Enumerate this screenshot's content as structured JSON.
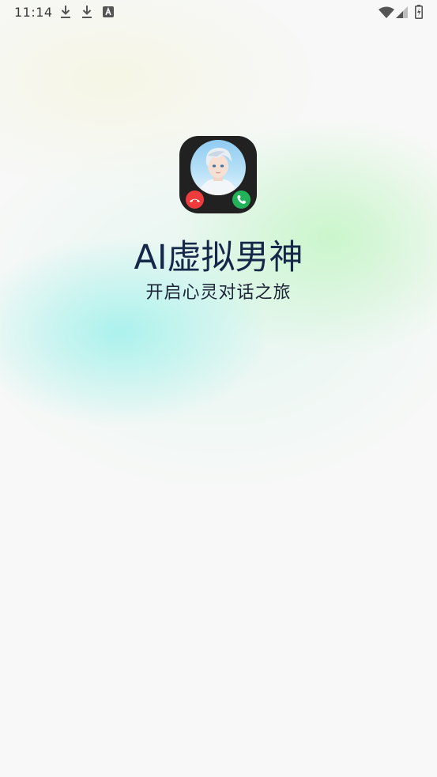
{
  "status_bar": {
    "time": "11:14",
    "icons": [
      "download-icon",
      "download-icon",
      "text-a-icon",
      "wifi-icon",
      "signal-icon",
      "battery-charging-icon"
    ]
  },
  "splash": {
    "app_icon": "call-avatar-icon",
    "title": "AI虚拟男神",
    "subtitle": "开启心灵对话之旅"
  },
  "colors": {
    "title": "#16284a",
    "decline": "#ee3c3c",
    "accept": "#22b25a",
    "icon_bg": "#212121"
  }
}
